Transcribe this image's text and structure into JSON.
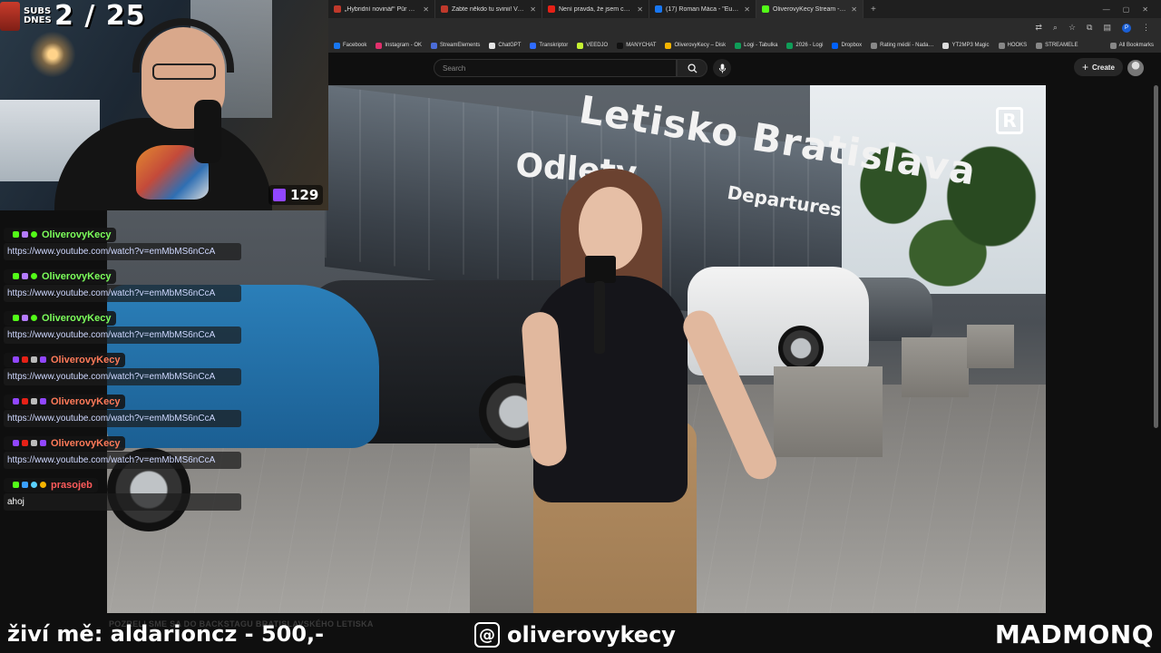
{
  "browser": {
    "tabs": [
      {
        "label": "„Hybridní novinář“ Půr má komu…",
        "color": "#c0392b"
      },
      {
        "label": "Zabte někdo tu svinii! Vyhrožov…",
        "color": "#c0392b"
      },
      {
        "label": "Není pravda, že jsem chtěla zak…",
        "color": "#e62117"
      },
      {
        "label": "(17) Roman Máca - \"Europarlam…",
        "color": "#1877f2"
      },
      {
        "label": "OliverovyKecy Stream - Watch…",
        "color": "#53fc18"
      }
    ],
    "new_tab": "+",
    "profile_initial": "P",
    "bookmarks": [
      {
        "label": "Facebook",
        "color": "#1877f2"
      },
      {
        "label": "Instagram - OK",
        "color": "#e1306c"
      },
      {
        "label": "StreamElements",
        "color": "#4b6cd9"
      },
      {
        "label": "ChatGPT",
        "color": "#e5e5e5"
      },
      {
        "label": "Transkriptor",
        "color": "#2f6bff"
      },
      {
        "label": "VEEDJO",
        "color": "#c6f432"
      },
      {
        "label": "MANYCHAT",
        "color": "#111111"
      },
      {
        "label": "OliverovyKecy – Disk",
        "color": "#f4b400"
      },
      {
        "label": "Logi - Tabulka",
        "color": "#0f9d58"
      },
      {
        "label": "2026 - Logi",
        "color": "#0f9d58"
      },
      {
        "label": "Dropbox",
        "color": "#0061fe"
      },
      {
        "label": "Rating médií - Nada…",
        "color": "#888888"
      },
      {
        "label": "YT2MP3 Magic",
        "color": "#dddddd"
      },
      {
        "label": "HOOKS",
        "color": "#888888"
      },
      {
        "label": "STREAMELE",
        "color": "#888888"
      }
    ],
    "all_bookmarks": "All Bookmarks"
  },
  "youtube": {
    "search_placeholder": "Search",
    "create_label": "Create"
  },
  "video": {
    "sign_main": "Letisko Bratislava",
    "sign_odlety": "Odlety",
    "sign_departures": "Departures",
    "logo_letter": "R",
    "title_faint": "POZRELI SME SA DO BACKSTAGU BRATISLAVSKÉHO LETISKA"
  },
  "webcam": {
    "subs_label_line1": "SUBS",
    "subs_label_line2": "DNES",
    "subs_count": "2 / 25",
    "viewer_count": "129"
  },
  "chat": [
    {
      "user": "OliverovyKecy",
      "color": "#7cff5b",
      "badges": [
        "#53fc18",
        "#b57bff",
        "#53fc18"
      ],
      "text": "https://www.youtube.com/watch?v=emMbMS6nCcA"
    },
    {
      "user": "OliverovyKecy",
      "color": "#7cff5b",
      "badges": [
        "#53fc18",
        "#b57bff",
        "#53fc18"
      ],
      "text": "https://www.youtube.com/watch?v=emMbMS6nCcA"
    },
    {
      "user": "OliverovyKecy",
      "color": "#7cff5b",
      "badges": [
        "#53fc18",
        "#b57bff",
        "#53fc18"
      ],
      "text": "https://www.youtube.com/watch?v=emMbMS6nCcA"
    },
    {
      "user": "OliverovyKecy",
      "color": "#ff7a59",
      "badges": [
        "#9146ff",
        "#e62117",
        "#bbbbbb",
        "#9146ff"
      ],
      "text": "https://www.youtube.com/watch?v=emMbMS6nCcA"
    },
    {
      "user": "OliverovyKecy",
      "color": "#ff7a59",
      "badges": [
        "#9146ff",
        "#e62117",
        "#bbbbbb",
        "#9146ff"
      ],
      "text": "https://www.youtube.com/watch?v=emMbMS6nCcA"
    },
    {
      "user": "OliverovyKecy",
      "color": "#ff7a59",
      "badges": [
        "#9146ff",
        "#e62117",
        "#bbbbbb",
        "#9146ff"
      ],
      "text": "https://www.youtube.com/watch?v=emMbMS6nCcA"
    },
    {
      "user": "prasojeb",
      "color": "#ff5b5b",
      "badges": [
        "#53fc18",
        "#3aa0ff",
        "#5ad1ff",
        "#f5b400"
      ],
      "text": "ahoj"
    }
  ],
  "ticker": {
    "left": "živí mě: aldarioncz - 500,-",
    "threads_glyph": "@",
    "handle": "oliverovykecy",
    "right": "MADMONQ"
  }
}
